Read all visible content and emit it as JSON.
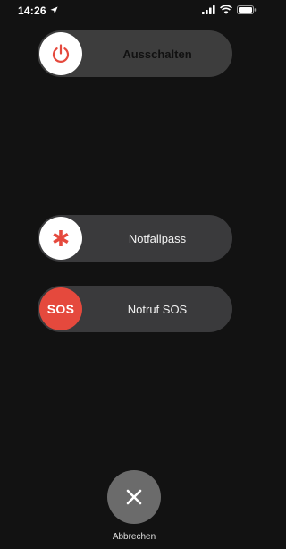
{
  "status_bar": {
    "time": "14:26",
    "icons": [
      "location-arrow-icon",
      "signal-icon",
      "wifi-icon",
      "battery-icon"
    ]
  },
  "sliders": {
    "power_off": {
      "label": "Ausschalten",
      "icon": "power-icon",
      "icon_color": "#e5493d"
    },
    "medical_id": {
      "label": "Notfallpass",
      "icon": "asterisk-icon",
      "icon_color": "#e5493d"
    },
    "emergency_sos": {
      "label": "Notruf SOS",
      "knob_text": "SOS",
      "knob_color": "#e5493d"
    }
  },
  "cancel": {
    "label": "Abbrechen",
    "icon": "close-icon"
  },
  "colors": {
    "background": "#121212",
    "slider": "#3a3a3c",
    "accent": "#e5493d",
    "cancel_button": "#6b6b6b"
  }
}
